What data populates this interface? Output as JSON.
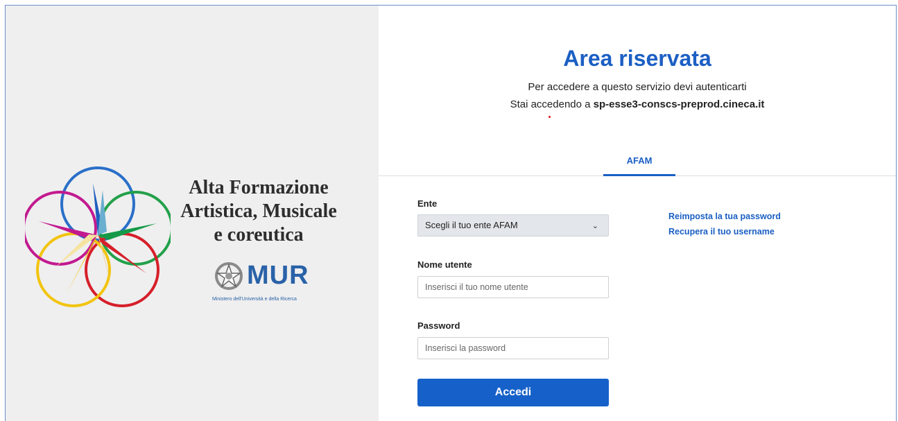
{
  "brand": {
    "lines": [
      "Alta Formazione",
      "Artistica, Musicale",
      "e coreutica"
    ],
    "mur_text": "MUR",
    "mur_subtitle": "Ministero dell'Università e della Ricerca"
  },
  "header": {
    "title": "Area riservata",
    "subtitle": "Per accedere a questo servizio devi autenticarti",
    "accessing_prefix": "Stai accedendo a ",
    "accessing_host": "sp-esse3-conscs-preprod.cineca.it"
  },
  "tabs": [
    {
      "label": "AFAM",
      "active": true
    }
  ],
  "form": {
    "ente_label": "Ente",
    "ente_selected": "Scegli il tuo ente AFAM",
    "username_label": "Nome utente",
    "username_placeholder": "Inserisci il tuo nome utente",
    "password_label": "Password",
    "password_placeholder": "Inserisci la password",
    "submit_label": "Accedi"
  },
  "links": {
    "reset_password": "Reimposta la tua password",
    "recover_username": "Recupera il tuo username"
  },
  "colors": {
    "accent": "#1b5fc4",
    "button": "#1661c9",
    "left_panel_bg": "#efefef"
  }
}
